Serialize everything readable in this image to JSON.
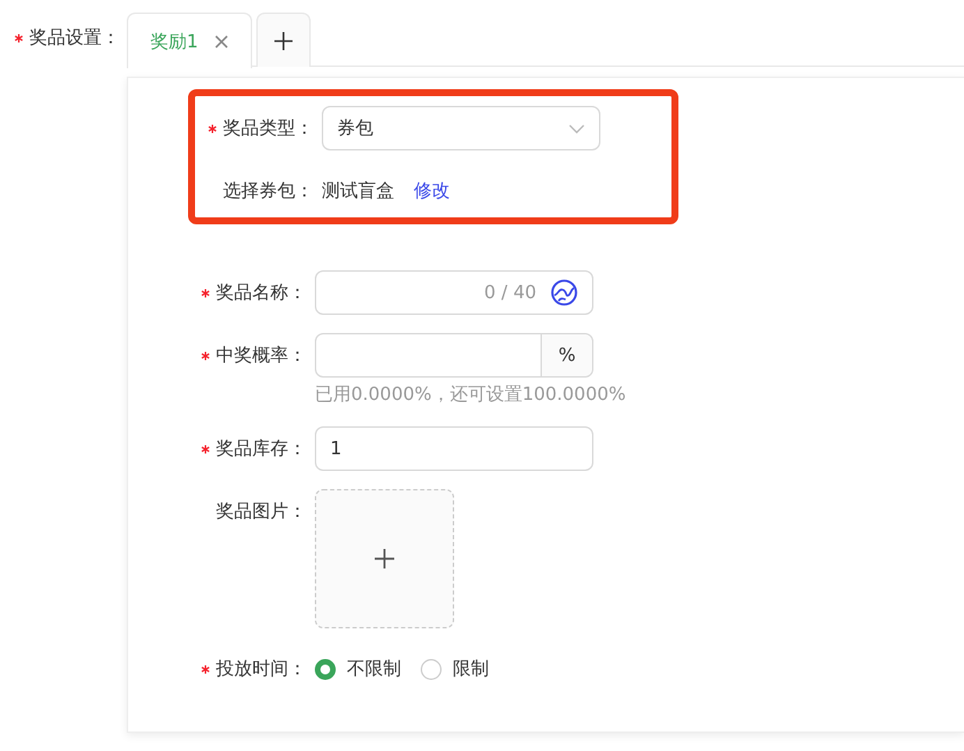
{
  "section_label": {
    "text": "奖品设置：",
    "required": true
  },
  "tabs": [
    {
      "label": "奖励1",
      "selected": true,
      "closable": true
    }
  ],
  "add_tab": true,
  "highlight": true,
  "fields": [
    {
      "kind": "select",
      "label": "奖品类型：",
      "required": true,
      "value": "券包"
    },
    {
      "kind": "info",
      "label": "选择券包：",
      "required": false,
      "value": "测试盲盒",
      "link": "修改"
    },
    {
      "kind": "text",
      "label": "奖品名称：",
      "required": true,
      "counter": "0 / 40"
    },
    {
      "kind": "suffix",
      "label": "中奖概率：",
      "required": true,
      "suffix": "%",
      "hint": "已用0.0000%，还可设置100.0000%"
    },
    {
      "kind": "text",
      "label": "奖品库存：",
      "required": true,
      "value": "1"
    },
    {
      "kind": "upload",
      "label": "奖品图片：",
      "required": false
    },
    {
      "kind": "radio",
      "label": "投放时间：",
      "required": true,
      "options": [
        {
          "label": "不限制",
          "selected": true
        },
        {
          "label": "限制",
          "selected": false
        }
      ]
    }
  ]
}
